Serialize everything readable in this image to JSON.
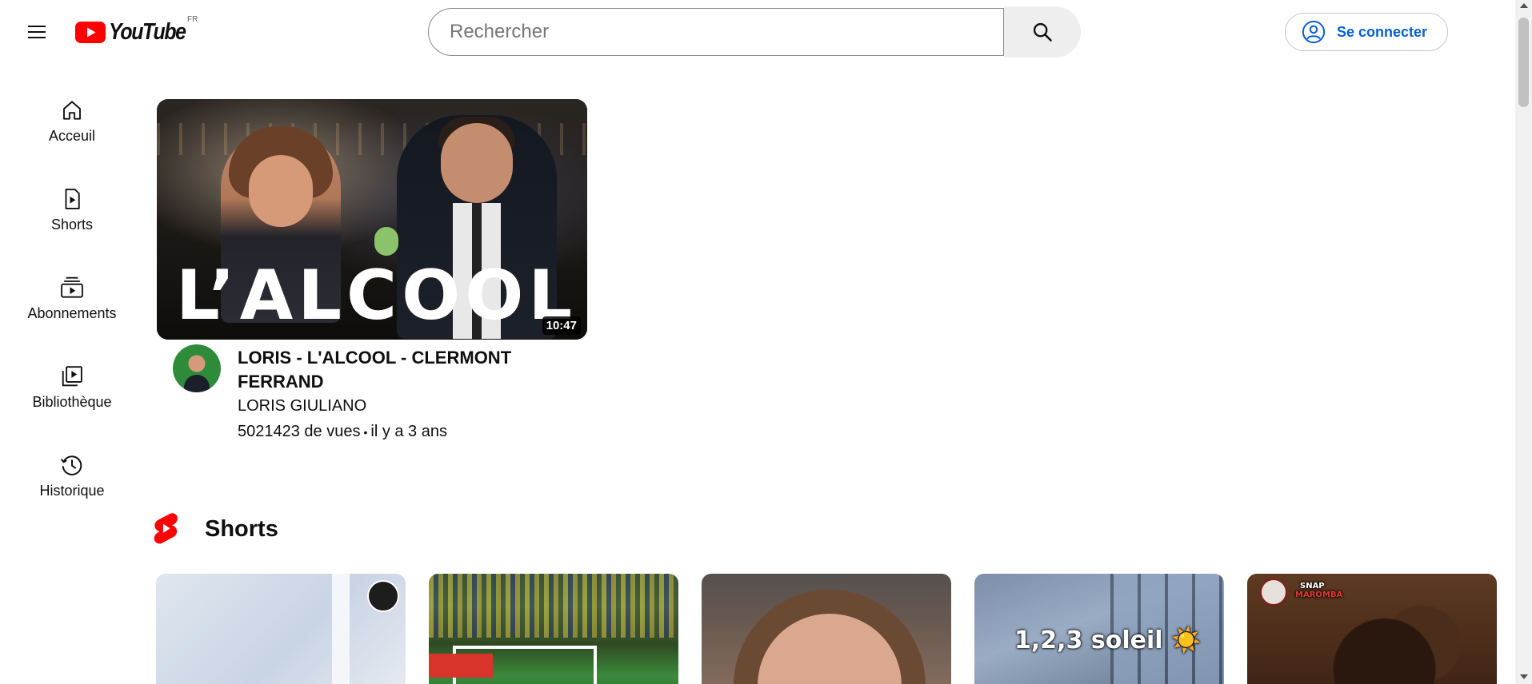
{
  "header": {
    "logo_text": "YouTube",
    "country_code": "FR",
    "search_placeholder": "Rechercher",
    "search_value": "",
    "signin_label": "Se connecter"
  },
  "sidebar": {
    "items": [
      {
        "label": "Acceuil",
        "icon": "home-icon"
      },
      {
        "label": "Shorts",
        "icon": "shorts-icon"
      },
      {
        "label": "Abonnements",
        "icon": "subscriptions-icon"
      },
      {
        "label": "Bibliothèque",
        "icon": "library-icon"
      },
      {
        "label": "Historique",
        "icon": "history-icon"
      }
    ]
  },
  "video": {
    "thumbnail_text": "L’ALCOOL",
    "duration": "10:47",
    "title": "LORIS - L'ALCOOL - CLERMONT FERRAND",
    "channel": "LORIS GIULIANO",
    "views": "5021423 de vues",
    "separator": "•",
    "age": "il y a 3 ans"
  },
  "shorts": {
    "title": "Shorts",
    "items": [
      {
        "caption": ""
      },
      {
        "caption": ""
      },
      {
        "caption": ""
      },
      {
        "caption": "1,2,3 soleil ☀️"
      },
      {
        "caption": "",
        "badge_line1": "SNAP",
        "badge_line2": "MAROMBA"
      }
    ]
  },
  "colors": {
    "brand_red": "#ff0000",
    "link_blue": "#065fd4",
    "text_primary": "#0f0f0f"
  }
}
